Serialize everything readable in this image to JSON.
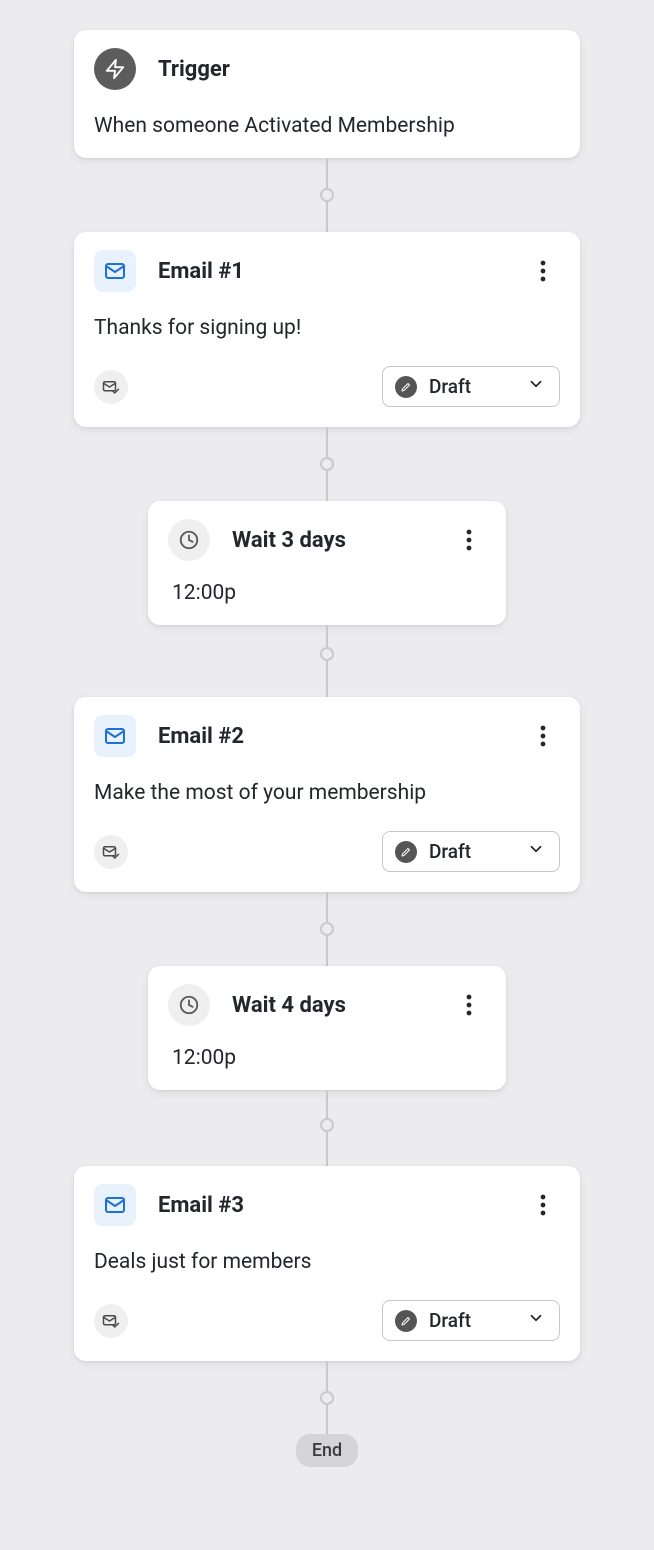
{
  "trigger": {
    "title": "Trigger",
    "description": "When someone Activated Membership"
  },
  "emails": [
    {
      "title": "Email #1",
      "subject": "Thanks for signing up!",
      "status": "Draft"
    },
    {
      "title": "Email #2",
      "subject": "Make the most of your membership",
      "status": "Draft"
    },
    {
      "title": "Email #3",
      "subject": "Deals just for members",
      "status": "Draft"
    }
  ],
  "waits": [
    {
      "title": "Wait 3 days",
      "time": "12:00p"
    },
    {
      "title": "Wait 4 days",
      "time": "12:00p"
    }
  ],
  "end_label": "End"
}
